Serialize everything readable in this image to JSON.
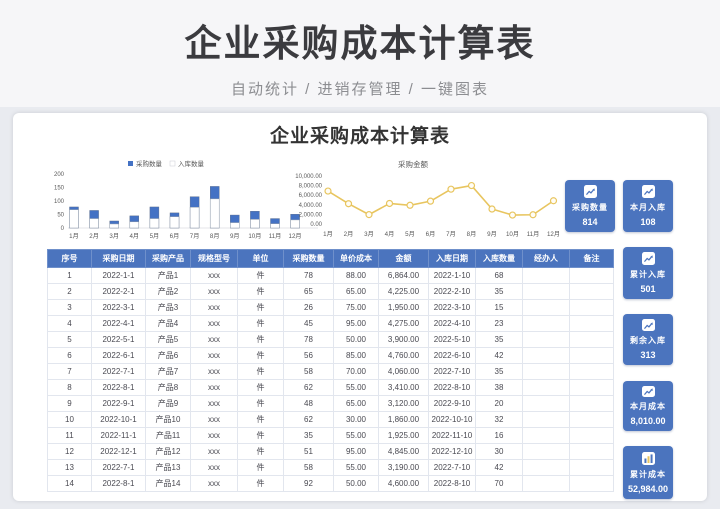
{
  "banner": {
    "title": "企业采购成本计算表",
    "subtitle": "自动统计  /  进销存管理  /  一键图表"
  },
  "card": {
    "title": "企业采购成本计算表"
  },
  "colors": {
    "accent_blue": "#4b74be",
    "bar_blue": "#4472c4",
    "bar_outline": "#8b97a8",
    "line_gold": "#e8c55f",
    "axis_text": "#595959",
    "header_bg": "#f6f6f8",
    "section_bg": "#e9ebf0"
  },
  "chart_data": [
    {
      "type": "bar",
      "title": "",
      "legend": [
        "采购数量",
        "入库数量"
      ],
      "legend_position": "top",
      "categories": [
        "1月",
        "2月",
        "3月",
        "4月",
        "5月",
        "6月",
        "7月",
        "8月",
        "9月",
        "10月",
        "11月",
        "12月"
      ],
      "series": [
        {
          "name": "采购数量",
          "color": "#4472c4",
          "values": [
            78,
            65,
            26,
            45,
            78,
            56,
            116,
            154,
            48,
            62,
            35,
            51
          ]
        },
        {
          "name": "入库数量",
          "color": "#ffffff",
          "values": [
            68,
            35,
            15,
            23,
            35,
            42,
            77,
            108,
            20,
            32,
            16,
            30
          ]
        }
      ],
      "xlabel": "",
      "ylabel": "",
      "ylim": [
        0,
        200
      ],
      "yticks": [
        "0",
        "50",
        "100",
        "150",
        "200"
      ],
      "grid": false
    },
    {
      "type": "line",
      "title": "采购金额",
      "categories": [
        "1月",
        "2月",
        "3月",
        "4月",
        "5月",
        "6月",
        "7月",
        "8月",
        "9月",
        "10月",
        "11月",
        "12月"
      ],
      "values": [
        6864,
        4225,
        1950,
        4275,
        3900,
        4760,
        7250,
        8010,
        3120,
        1860,
        1925,
        4845
      ],
      "xlabel": "",
      "ylabel": "",
      "ylim": [
        0,
        10000
      ],
      "yticks": [
        "0.00",
        "2,000.00",
        "4,000.00",
        "6,000.00",
        "8,000.00",
        "10,000.00"
      ],
      "grid": false,
      "marker": "circle",
      "color": "#e8c55f"
    }
  ],
  "stat_cards": [
    {
      "label": "采购数量",
      "value": "814",
      "icon": "trend-up-icon"
    },
    {
      "label": "本月入库",
      "value": "108",
      "icon": "trend-up-icon"
    },
    {
      "label": "累计入库",
      "value": "501",
      "icon": "trend-up-icon"
    },
    {
      "label": "剩余入库",
      "value": "313",
      "icon": "trend-up-icon"
    },
    {
      "label": "本月成本",
      "value": "8,010.00",
      "icon": "trend-up-icon"
    },
    {
      "label": "累计成本",
      "value": "52,984.00",
      "icon": "bar-chart-icon"
    }
  ],
  "table": {
    "headers": [
      "序号",
      "采购日期",
      "采购产品",
      "规格型号",
      "单位",
      "采购数量",
      "单价成本",
      "金额",
      "入库日期",
      "入库数量",
      "经办人",
      "备注"
    ],
    "rows": [
      [
        "1",
        "2022-1-1",
        "产品1",
        "xxx",
        "件",
        "78",
        "88.00",
        "6,864.00",
        "2022-1-10",
        "68",
        "",
        ""
      ],
      [
        "2",
        "2022-2-1",
        "产品2",
        "xxx",
        "件",
        "65",
        "65.00",
        "4,225.00",
        "2022-2-10",
        "35",
        "",
        ""
      ],
      [
        "3",
        "2022-3-1",
        "产品3",
        "xxx",
        "件",
        "26",
        "75.00",
        "1,950.00",
        "2022-3-10",
        "15",
        "",
        ""
      ],
      [
        "4",
        "2022-4-1",
        "产品4",
        "xxx",
        "件",
        "45",
        "95.00",
        "4,275.00",
        "2022-4-10",
        "23",
        "",
        ""
      ],
      [
        "5",
        "2022-5-1",
        "产品5",
        "xxx",
        "件",
        "78",
        "50.00",
        "3,900.00",
        "2022-5-10",
        "35",
        "",
        ""
      ],
      [
        "6",
        "2022-6-1",
        "产品6",
        "xxx",
        "件",
        "56",
        "85.00",
        "4,760.00",
        "2022-6-10",
        "42",
        "",
        ""
      ],
      [
        "7",
        "2022-7-1",
        "产品7",
        "xxx",
        "件",
        "58",
        "70.00",
        "4,060.00",
        "2022-7-10",
        "35",
        "",
        ""
      ],
      [
        "8",
        "2022-8-1",
        "产品8",
        "xxx",
        "件",
        "62",
        "55.00",
        "3,410.00",
        "2022-8-10",
        "38",
        "",
        ""
      ],
      [
        "9",
        "2022-9-1",
        "产品9",
        "xxx",
        "件",
        "48",
        "65.00",
        "3,120.00",
        "2022-9-10",
        "20",
        "",
        ""
      ],
      [
        "10",
        "2022-10-1",
        "产品10",
        "xxx",
        "件",
        "62",
        "30.00",
        "1,860.00",
        "2022-10-10",
        "32",
        "",
        ""
      ],
      [
        "11",
        "2022-11-1",
        "产品11",
        "xxx",
        "件",
        "35",
        "55.00",
        "1,925.00",
        "2022-11-10",
        "16",
        "",
        ""
      ],
      [
        "12",
        "2022-12-1",
        "产品12",
        "xxx",
        "件",
        "51",
        "95.00",
        "4,845.00",
        "2022-12-10",
        "30",
        "",
        ""
      ],
      [
        "13",
        "2022-7-1",
        "产品13",
        "xxx",
        "件",
        "58",
        "55.00",
        "3,190.00",
        "2022-7-10",
        "42",
        "",
        ""
      ],
      [
        "14",
        "2022-8-1",
        "产品14",
        "xxx",
        "件",
        "92",
        "50.00",
        "4,600.00",
        "2022-8-10",
        "70",
        "",
        ""
      ]
    ]
  }
}
